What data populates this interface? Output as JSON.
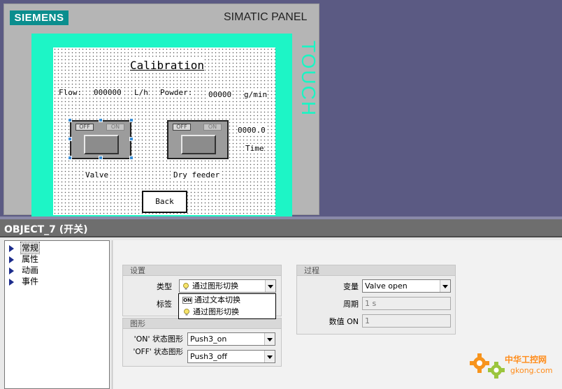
{
  "hmi_panel": {
    "brand_logo": "SIEMENS",
    "model_label": "SIMATIC PANEL",
    "side_label": "TOUCH",
    "screen": {
      "title": "Calibration",
      "flow_label": "Flow:",
      "flow_value": "000000",
      "flow_unit": "L/h",
      "powder_label": "Powder:",
      "powder_value": "00000",
      "powder_unit": "g/min",
      "valve_button": {
        "off_label": "OFF",
        "on_label": "ON",
        "caption": "Valve"
      },
      "feeder_button": {
        "off_label": "OFF",
        "on_label": "ON",
        "caption": "Dry feeder"
      },
      "time_value": "0000.0",
      "time_label": "Time",
      "back_button": "Back"
    }
  },
  "properties": {
    "header_title": "OBJECT_7 (开关)",
    "tree": [
      {
        "label": "常规",
        "selected": true
      },
      {
        "label": "属性",
        "selected": false
      },
      {
        "label": "动画",
        "selected": false
      },
      {
        "label": "事件",
        "selected": false
      }
    ],
    "settings_group": {
      "title": "设置",
      "type_label": "类型",
      "type_value": "通过图形切换",
      "tag_label": "标签"
    },
    "type_dropdown": {
      "options": [
        {
          "chip": "ON",
          "label": "通过文本切换"
        },
        {
          "icon": "bulb-icon",
          "label": "通过图形切换"
        }
      ]
    },
    "graphics_group": {
      "title": "图形",
      "on_label": "'ON' 状态图形",
      "on_value": "Push3_on",
      "off_label": "'OFF' 状态图形",
      "off_value": "Push3_off"
    },
    "process_group": {
      "title": "过程",
      "variable_label": "变量",
      "variable_value": "Valve open",
      "period_label": "周期",
      "period_value": "1 s",
      "on_value_label": "数值 ON",
      "on_value_value": "1"
    }
  },
  "watermark": {
    "line1": "中华工控网",
    "line2": "gkong.com"
  },
  "colors": {
    "workspace_bg": "#5b5a83",
    "panel_bezel": "#b5b5b5",
    "screen_frame": "#1df5c6",
    "siemens_teal": "#0a8e8e",
    "tree_arrow": "#1c2c8c",
    "header_bg": "#6e6e6e"
  }
}
